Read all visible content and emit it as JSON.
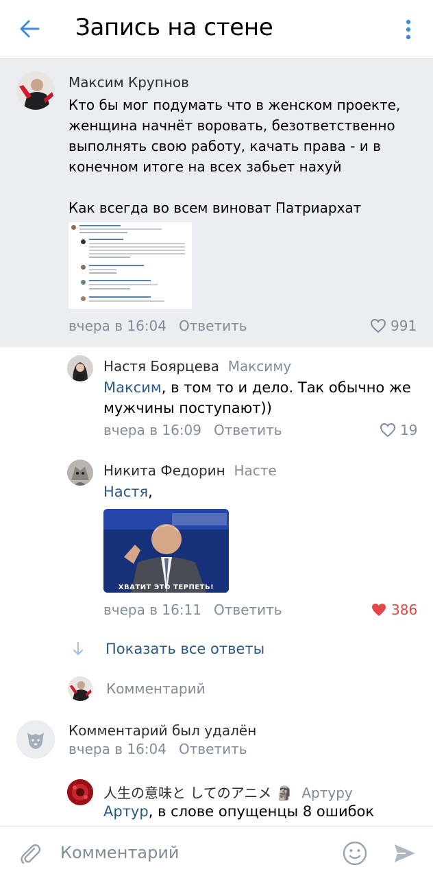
{
  "header": {
    "title": "Запись на стене"
  },
  "post": {
    "author": "Максим Крупнов",
    "text_lines": [
      "Кто бы мог подумать что в женском проекте,",
      "женщина начнёт воровать, безответственно",
      "выполнять свою работу, качать права - и в",
      "конечном итоге на всех забьет нахуй"
    ],
    "text_tail": "Как всегда во всем виноват Патриархат",
    "time": "вчера в 16:04",
    "reply_label": "Ответить",
    "likes": "991"
  },
  "comments": [
    {
      "author": "Настя Боярцева",
      "reply_to": "Максиму",
      "mention": "Максим",
      "text_line1": ", в том то и дело. Так обычно же",
      "text_line2": "мужчины поступают))",
      "time": "вчера в 16:09",
      "reply_label": "Ответить",
      "likes": "19"
    },
    {
      "author": "Никита Федорин",
      "reply_to": "Насте",
      "mention": "Настя",
      "text_line1": ",",
      "gif_caption": "ХВАТИТ ЭТО ТЕРПЕТЬ!",
      "time": "вчера в 16:11",
      "reply_label": "Ответить",
      "likes": "386"
    }
  ],
  "show_all": {
    "label": "Показать все ответы"
  },
  "inline_reply": {
    "placeholder": "Комментарий"
  },
  "deleted": {
    "text": "Комментарий был удалён",
    "time": "вчера в 16:04",
    "reply_label": "Ответить"
  },
  "last_comment": {
    "author": "人生の意味と してのアニメ 🗿",
    "reply_to": "Артуру",
    "mention": "Артур",
    "text_line1": ", в слове опущенцы 8 ошибок"
  },
  "composer": {
    "placeholder": "Комментарий"
  },
  "colors": {
    "accent": "#2a5885",
    "icon_blue": "#3f8ae0",
    "muted": "#818c99",
    "like_red": "#e64646",
    "post_bg": "#ebedf0"
  }
}
